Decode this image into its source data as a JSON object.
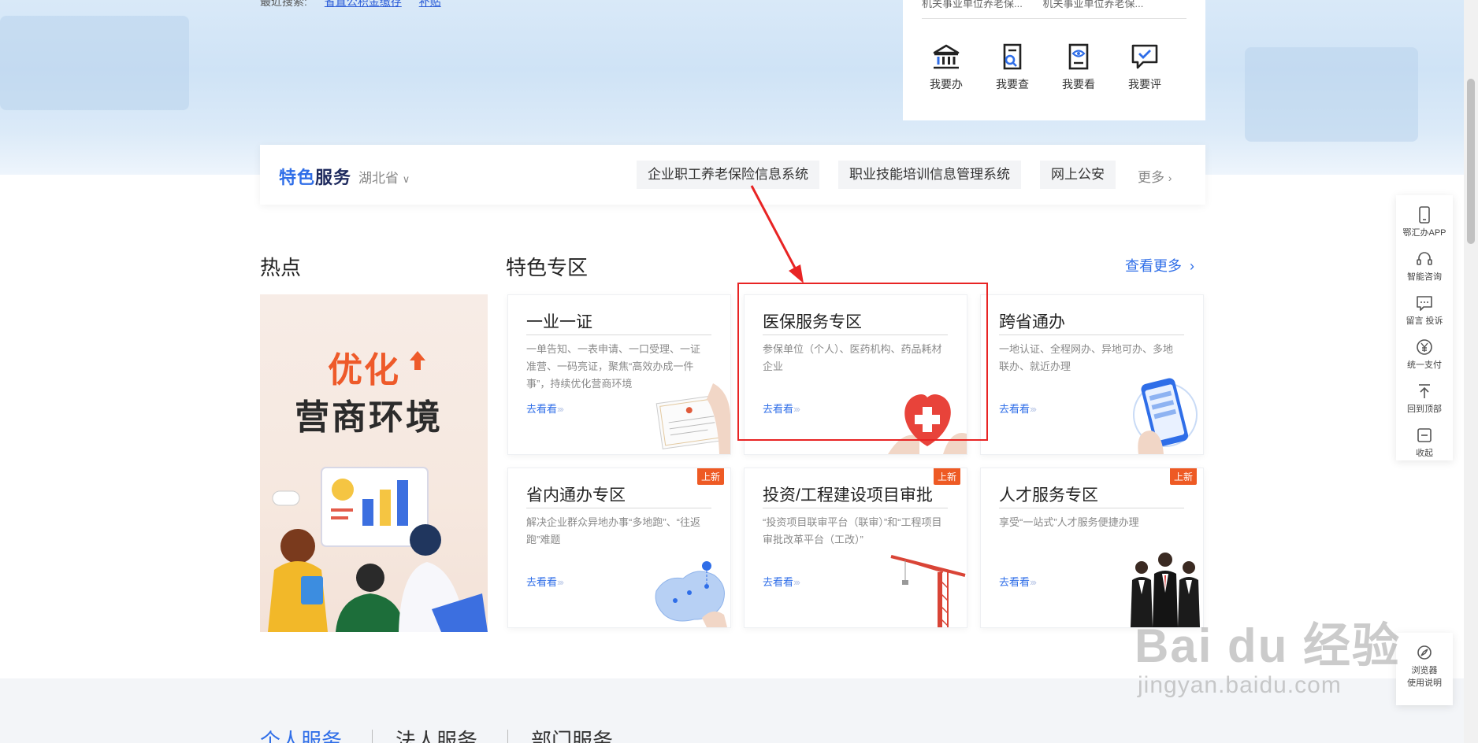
{
  "hero": {
    "top_text": "最近搜索:",
    "top_link_1": "省直公积金缴存",
    "top_link_2": "补贴"
  },
  "quick_card": {
    "notice_1": "机关事业单位养老保...",
    "notice_2": "机关事业单位养老保...",
    "items": [
      {
        "label": "我要办",
        "icon": "bank-icon"
      },
      {
        "label": "我要查",
        "icon": "search-doc-icon"
      },
      {
        "label": "我要看",
        "icon": "eye-doc-icon"
      },
      {
        "label": "我要评",
        "icon": "comment-check-icon"
      }
    ]
  },
  "feature_bar": {
    "title_blue": "特色",
    "title_dark": "服务",
    "region": "湖北省",
    "chips": [
      "企业职工养老保险信息系统",
      "职业技能培训信息管理系统",
      "网上公安"
    ],
    "more": "更多"
  },
  "hot": {
    "title": "热点",
    "banner_line1": "优化",
    "banner_line2": "营商环境"
  },
  "zone": {
    "title": "特色专区",
    "see_more": "查看更多",
    "link_text": "去看看",
    "badge_text": "上新",
    "cards": [
      {
        "title": "一业一证",
        "desc": "一单告知、一表申请、一口受理、一证准营、一码亮证，聚焦“高效办成一件事”，持续优化营商环境"
      },
      {
        "title": "医保服务专区",
        "desc": "参保单位（个人）、医药机构、药品耗材企业"
      },
      {
        "title": "跨省通办",
        "desc": "一地认证、全程网办、异地可办、多地联办、就近办理"
      },
      {
        "title": "省内通办专区",
        "desc": "解决企业群众异地办事“多地跑”、“往返跑”难题"
      },
      {
        "title": "投资/工程建设项目审批",
        "desc": "“投资项目联审平台（联审）”和“工程项目审批改革平台（工改）”"
      },
      {
        "title": "人才服务专区",
        "desc": "享受“一站式”人才服务便捷办理"
      }
    ]
  },
  "tabs": [
    "个人服务",
    "法人服务",
    "部门服务"
  ],
  "float_toolbar": {
    "items": [
      "鄂汇办APP",
      "智能咨询",
      "留言 投诉",
      "统一支付",
      "回到顶部",
      "收起"
    ],
    "browser_line1": "浏览器",
    "browser_line2": "使用说明"
  },
  "watermark": {
    "big": "Bai du 经验",
    "small": "jingyan.baidu.com"
  },
  "colors": {
    "accent_blue": "#2f6ee8",
    "badge_orange": "#ee5a24",
    "highlight_red": "#e82424"
  }
}
